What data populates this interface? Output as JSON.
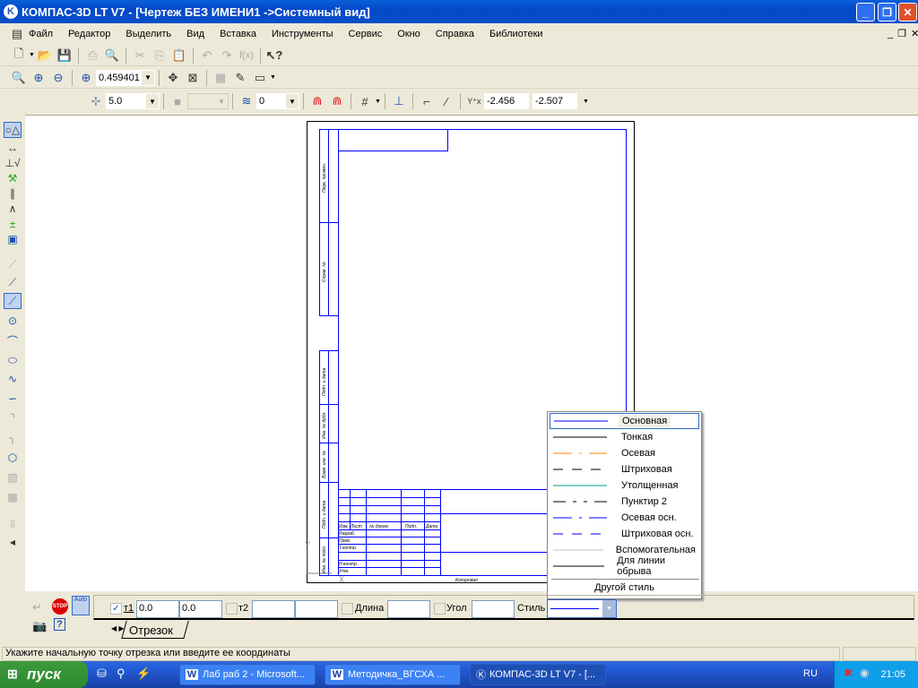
{
  "window": {
    "title": "КОМПАС-3D LT V7 - [Чертеж БЕЗ ИМЕНИ1 ->Системный вид]"
  },
  "menu": [
    "Файл",
    "Редактор",
    "Выделить",
    "Вид",
    "Вставка",
    "Инструменты",
    "Сервис",
    "Окно",
    "Справка",
    "Библиотеки"
  ],
  "toolbar": {
    "zoom_value": "0.459401",
    "step_value": "5.0",
    "layer_value": "0",
    "coord_x": "-2.456",
    "coord_y": "-2.507",
    "fx_label": "f(x)"
  },
  "drawing": {
    "side_labels": [
      "Перв. примен.",
      "Справ. №",
      "Подп. и дата",
      "Инв. № дубл.",
      "Взам. инв. №",
      "Подп. и дата",
      "Инв. № подл."
    ],
    "header_labels": [
      "Изм.",
      "Лист",
      "№ докум.",
      "Подп.",
      "Дата"
    ],
    "role_labels": [
      "Разраб.",
      "Пров.",
      "Т.контр.",
      "Н.контр.",
      "Утв."
    ],
    "copied_label": "Копировал",
    "axis_x": "X",
    "axis_y": "Y"
  },
  "style_dropdown": {
    "items": [
      {
        "label": "Основная",
        "color": "#0000ff",
        "dash": "solid"
      },
      {
        "label": "Тонкая",
        "color": "#000000",
        "dash": "solid"
      },
      {
        "label": "Осевая",
        "color": "#ff8000",
        "dash": "axis"
      },
      {
        "label": "Штриховая",
        "color": "#000000",
        "dash": "dashed"
      },
      {
        "label": "Утолщенная",
        "color": "#009999",
        "dash": "solid"
      },
      {
        "label": "Пунктир 2",
        "color": "#000000",
        "dash": "dotdash"
      },
      {
        "label": "Осевая осн.",
        "color": "#0000ff",
        "dash": "axis"
      },
      {
        "label": "Штриховая осн.",
        "color": "#0000ff",
        "dash": "dashed"
      },
      {
        "label": "Вспомогательная",
        "color": "#c0c0c0",
        "dash": "solid"
      },
      {
        "label": "Для линии обрыва",
        "color": "#000000",
        "dash": "solid"
      }
    ],
    "other_label": "Другой стиль",
    "selected": "Основная"
  },
  "props": {
    "t1_label": "т1",
    "t1_x": "0.0",
    "t1_y": "0.0",
    "t2_label": "т2",
    "length_label": "Длина",
    "angle_label": "Угол",
    "style_label": "Стиль",
    "tab_label": "Отрезок",
    "auto_label": "Auto",
    "stop_label": "STOP"
  },
  "status": {
    "text": "Укажите начальную точку отрезка или введите ее координаты"
  },
  "taskbar": {
    "start_label": "пуск",
    "tasks": [
      "Лаб раб 2 - Microsoft...",
      "Методичка_ВГСХА  ...",
      "КОМПАС-3D LT V7 - [..."
    ],
    "lang": "RU",
    "clock": "21:05"
  }
}
